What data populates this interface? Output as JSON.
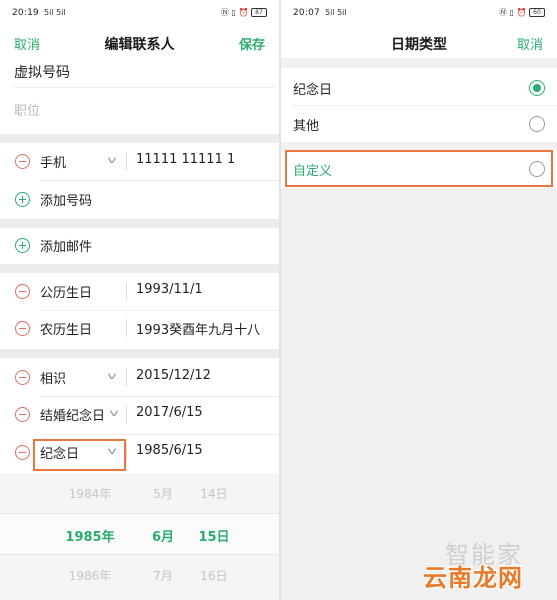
{
  "left": {
    "status": {
      "time": "20:19",
      "signal": "5il 5il",
      "battery": "87"
    },
    "topbar": {
      "cancel": "取消",
      "title": "编辑联系人",
      "save": "保存"
    },
    "virtual_number": "虚拟号码",
    "position_placeholder": "职位",
    "phone": {
      "label": "手机",
      "value": "11111 11111 1"
    },
    "add_phone": "添加号码",
    "add_email": "添加邮件",
    "dates": [
      {
        "label": "公历生日",
        "value": "1993/11/1"
      },
      {
        "label": "农历生日",
        "value": "1993癸酉年九月十八"
      }
    ],
    "events": [
      {
        "label": "相识",
        "value": "2015/12/12"
      },
      {
        "label": "结婚纪念日",
        "value": "2017/6/15"
      },
      {
        "label": "纪念日",
        "value": "1985/6/15"
      }
    ],
    "picker": {
      "prev": {
        "year": "1984年",
        "month": "5月",
        "day": "14日"
      },
      "selected": {
        "year": "1985年",
        "month": "6月",
        "day": "15日"
      },
      "next": {
        "year": "1986年",
        "month": "7月",
        "day": "16日"
      }
    }
  },
  "right": {
    "status": {
      "time": "20:07",
      "signal": "5il 5il",
      "battery": "60"
    },
    "topbar": {
      "title": "日期类型",
      "cancel": "取消"
    },
    "options": [
      {
        "label": "纪念日",
        "selected": true
      },
      {
        "label": "其他",
        "selected": false
      },
      {
        "label": "自定义",
        "selected": false
      }
    ]
  },
  "watermark": {
    "line1": "智能家",
    "line2": "云南龙网"
  },
  "colors": {
    "accent": "#2aad6e",
    "minus": "#e06d5e",
    "highlight": "#e8763d"
  }
}
